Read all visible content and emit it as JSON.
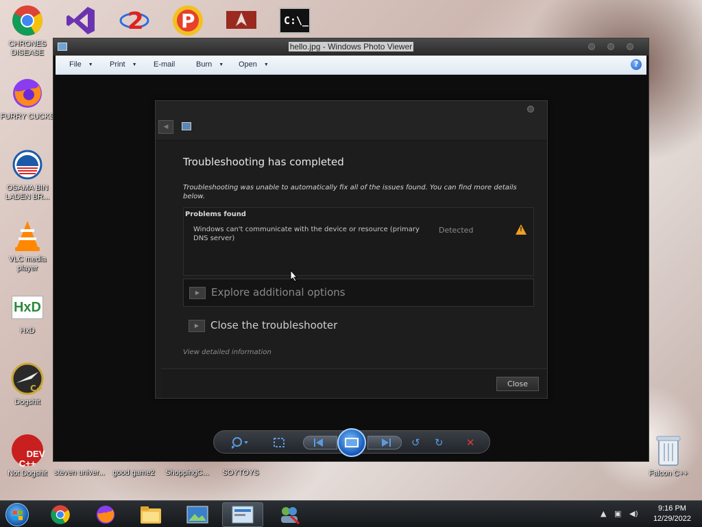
{
  "desktop": {
    "icons": [
      {
        "label": "CHRONES DISEASE",
        "icon": "chrome-icon"
      },
      {
        "label": "FURRY CUCKS",
        "icon": "firefox-icon"
      },
      {
        "label": "OSAMA BIN LADEN BR...",
        "icon": "obama-logo-icon"
      },
      {
        "label": "VLC media player",
        "icon": "vlc-icon"
      },
      {
        "label": "HxD",
        "icon": "hxd-icon"
      },
      {
        "label": "Dogshit",
        "icon": "codeblocks-icon"
      },
      {
        "label": "Not Dogshit",
        "icon": "devcpp-icon"
      },
      {
        "label": "steven univer...",
        "icon": "shortcut-icon"
      },
      {
        "label": "good game2",
        "icon": "shortcut-icon"
      },
      {
        "label": "ShoppingC...",
        "icon": "shortcut-icon"
      },
      {
        "label": "SOYTOYS",
        "icon": "shortcut-icon"
      },
      {
        "label": "Falcon C++",
        "icon": "recycle-bin-icon"
      }
    ],
    "devcpp_text": "DEV\nC++",
    "hxd_text": "HxD",
    "cmd_text": "C:\\_"
  },
  "window": {
    "title": "hello.jpg - Windows Photo Viewer",
    "menu": [
      {
        "label": "File",
        "has_arrow": true
      },
      {
        "label": "Print",
        "has_arrow": true
      },
      {
        "label": "E-mail",
        "has_arrow": false
      },
      {
        "label": "Burn",
        "has_arrow": true
      },
      {
        "label": "Open",
        "has_arrow": true
      }
    ],
    "help": "?"
  },
  "dialog": {
    "heading": "Troubleshooting has completed",
    "description": "Troubleshooting was unable to automatically fix all of the issues found. You can find more details below.",
    "problems_header": "Problems found",
    "problem_text": "Windows can't communicate with the device or resource (primary DNS server)",
    "problem_status": "Detected",
    "warning_glyph": "!",
    "option_explore": "Explore additional options",
    "option_close": "Close the troubleshooter",
    "view_details": "View detailed information",
    "close_button": "Close"
  },
  "taskbar": {
    "time": "9:16 PM",
    "date": "12/29/2022"
  },
  "colors": {
    "window_bg": "#0d0d0d",
    "dialog_bg": "#1d1d1d",
    "warning": "#f0a020",
    "accent_blue": "#1d5fc4"
  }
}
